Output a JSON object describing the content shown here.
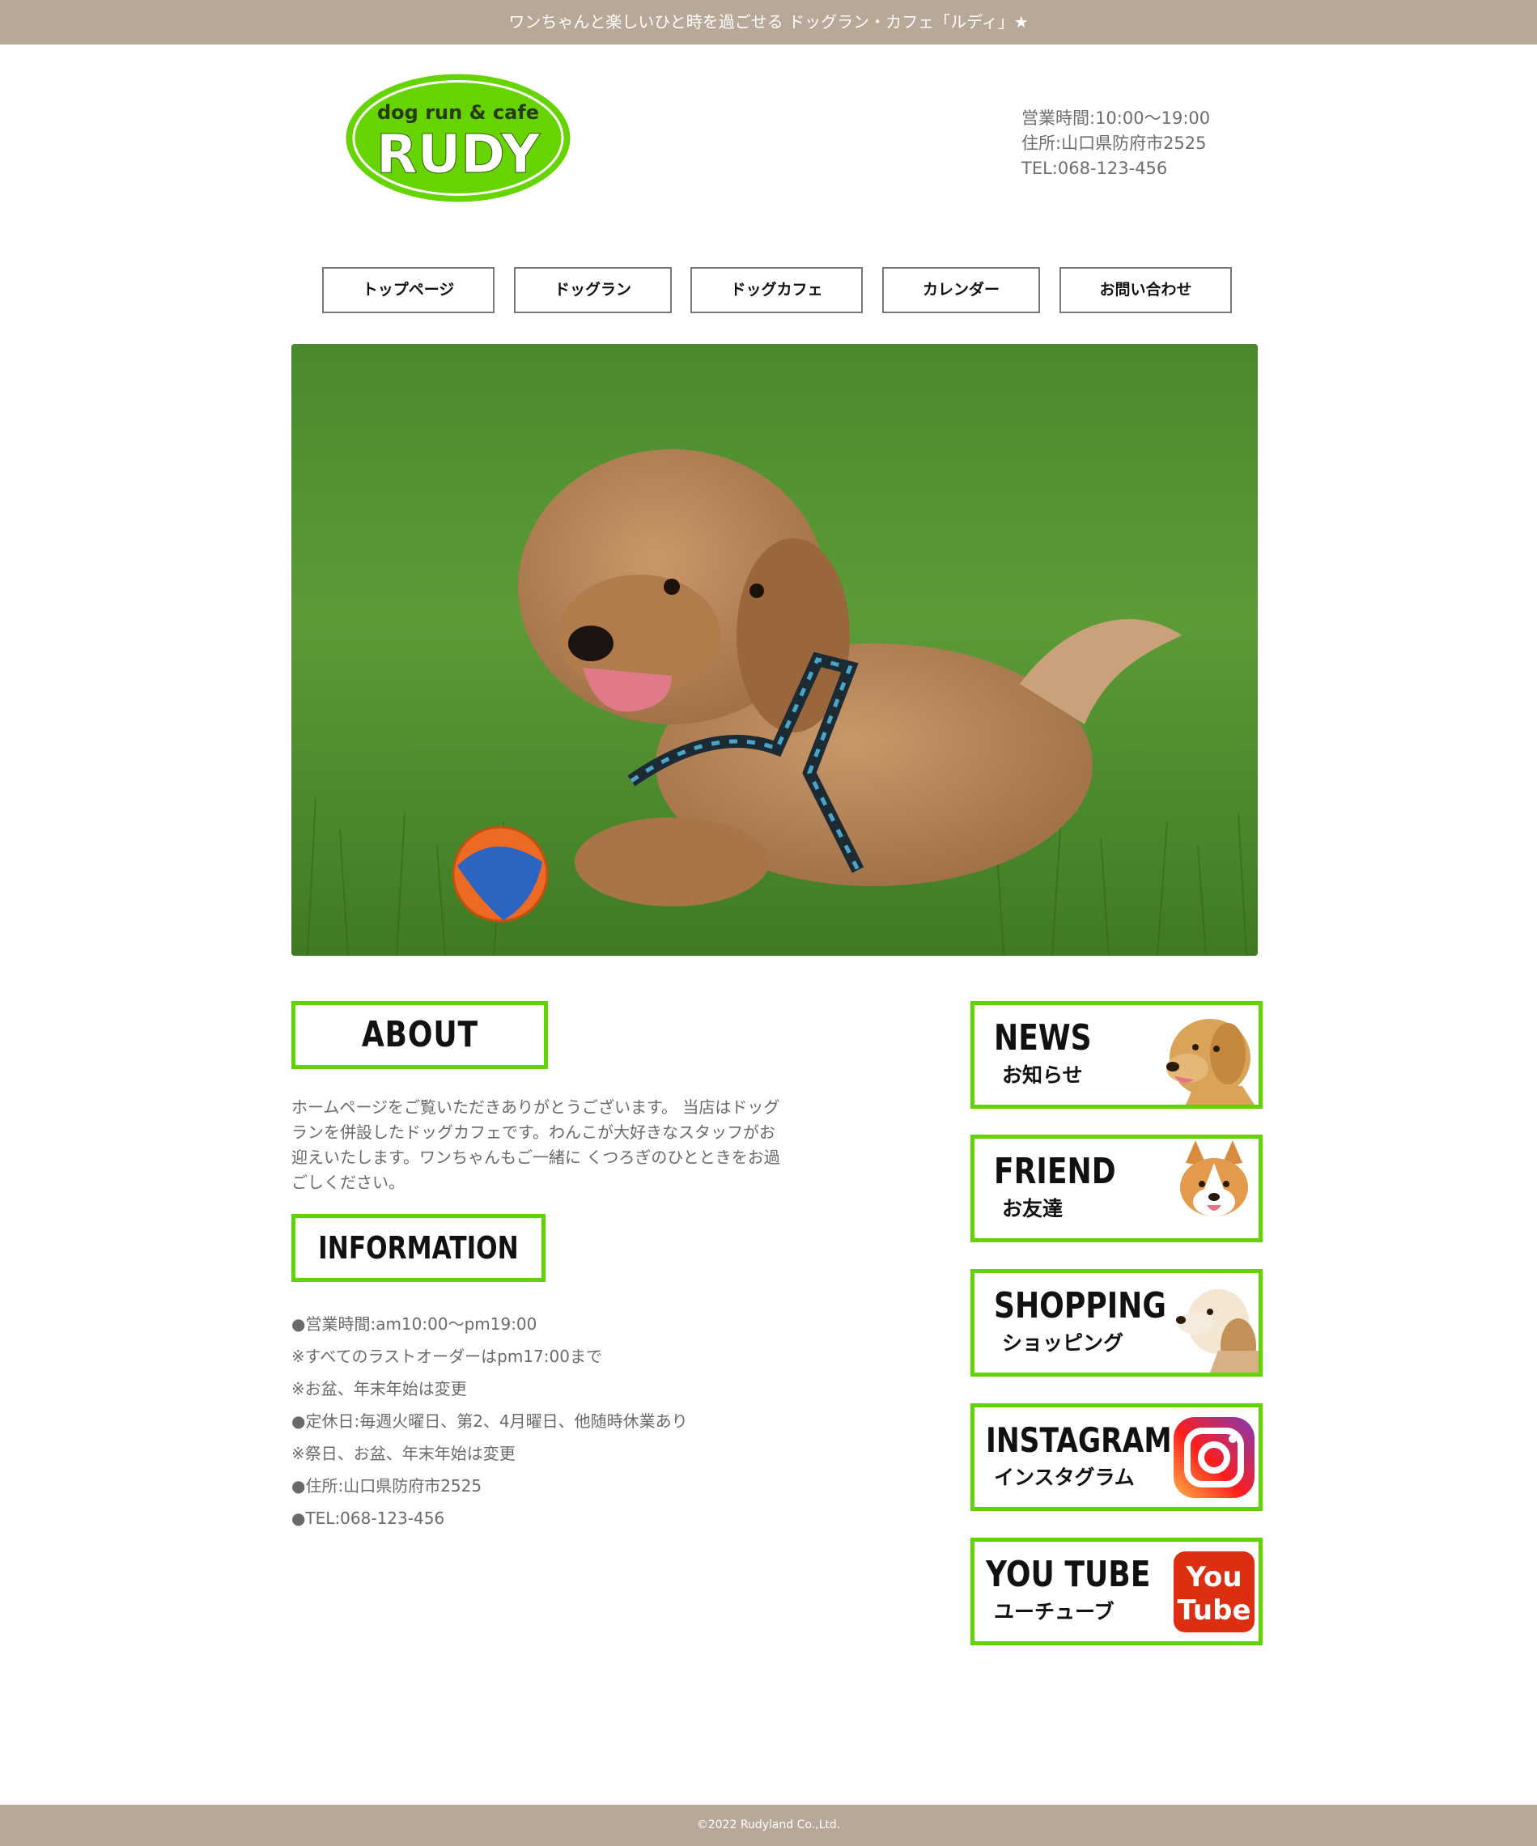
{
  "topbar": {
    "text": "ワンちゃんと楽しいひと時を過ごせる ドッグラン・カフェ「ルディ」★"
  },
  "logo": {
    "line1": "dog run & cafe",
    "line2": "RUDY"
  },
  "header": {
    "hours": "営業時間:10:00～19:00",
    "address": "住所:山口県防府市2525",
    "tel": "TEL:068-123-456"
  },
  "nav": [
    "トップページ",
    "ドッグラン",
    "ドッグカフェ",
    "カレンダー",
    "お問い合わせ"
  ],
  "about": {
    "heading": "ABOUT",
    "text": "ホームページをご覧いただきありがとうございます。 当店はドッグランを併設したドッグカフェです。わんこが大好きなスタッフがお迎えいたします。ワンちゃんもご一緒に くつろぎのひとときをお過ごしください。"
  },
  "information": {
    "heading": "INFORMATION",
    "items": [
      "●営業時間:am10:00～pm19:00",
      "※すべてのラストオーダーはpm17:00まで",
      "※お盆、年末年始は変更",
      "●定休日:毎週火曜日、第2、4月曜日、他随時休業あり",
      "※祭日、お盆、年末年始は変更",
      "●住所:山口県防府市2525",
      "●TEL:068-123-456"
    ]
  },
  "side": {
    "news": {
      "en": "NEWS",
      "ja": "お知らせ",
      "icon": "dog-photo-retriever"
    },
    "friend": {
      "en": "FRIEND",
      "ja": "お友達",
      "icon": "dog-photo-corgi"
    },
    "shopping": {
      "en": "SHOPPING",
      "ja": "ショッピング",
      "icon": "dog-photo-puppy"
    },
    "instagram": {
      "en": "INSTAGRAM",
      "ja": "インスタグラム",
      "icon": "instagram-icon"
    },
    "youtube": {
      "en": "YOU TUBE",
      "ja": "ユーチューブ",
      "icon": "youtube-icon",
      "icon_line1": "You",
      "icon_line2": "Tube"
    }
  },
  "footer": {
    "copyright": "©2022 Rudyland Co.,Ltd."
  },
  "colors": {
    "accent_green": "#5fd400",
    "bar_beige": "#b8a897",
    "logo_green": "#66d400"
  }
}
